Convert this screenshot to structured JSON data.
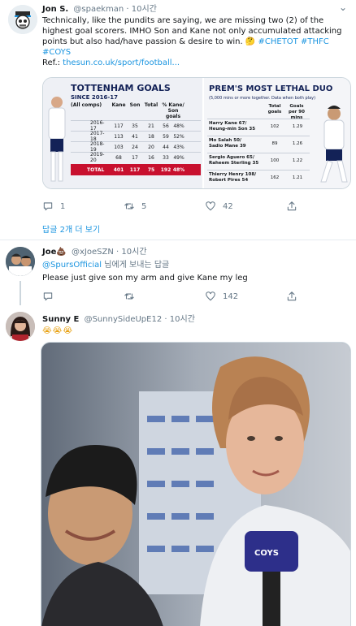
{
  "tweet1": {
    "name": "Jon S.",
    "handle": "@spaekman",
    "sep": "·",
    "time": "10시간",
    "line1": "Technically, like the pundits are saying, we are missing two (2) of the",
    "line2": "highest goal scorers. IMHO Son and Kane not only accumulated attacking",
    "line3a": "points but also had/have passion & desire to win. ",
    "line3emoji": "🤔",
    "line3b": " #CHETOT #THFC",
    "line4": "#COYS",
    "ref_prefix": "Ref.: ",
    "ref_link": "thesun.co.uk/sport/football...",
    "image": {
      "left_title": "TOTTENHAM GOALS",
      "left_subtitle": "SINCE 2016-17",
      "headers": [
        "(All comps)",
        "Kane",
        "Son",
        "Total",
        "% Kane/ Son goals"
      ],
      "rows": [
        [
          "2016-17",
          "117",
          "35",
          "21",
          "56",
          "48%"
        ],
        [
          "2017-18",
          "113",
          "41",
          "18",
          "59",
          "52%"
        ],
        [
          "2018-19",
          "103",
          "24",
          "20",
          "44",
          "43%"
        ],
        [
          "2019-20",
          "68",
          "17",
          "16",
          "33",
          "49%"
        ]
      ],
      "total_row": [
        "TOTAL",
        "401",
        "117",
        "75",
        "192",
        "48%"
      ],
      "right_title": "PREM'S MOST LETHAL DUO",
      "right_subtitle": "(5,000 mins or more together. Data when both play)",
      "right_headers": [
        "Total goals",
        "Goals per 90 mins"
      ],
      "duos": [
        {
          "name1": "Harry Kane 67/",
          "name2": "Heung-min Son ",
          "n2val": "35",
          "total": "102",
          "per90": "1.29"
        },
        {
          "name1": "Mo Salah 50/",
          "name2": "Sadio Mane ",
          "n2val": "39",
          "total": "89",
          "per90": "1.26"
        },
        {
          "name1": "Sergio Aguero 65/",
          "name2": "Raheem Sterling ",
          "n2val": "35",
          "total": "100",
          "per90": "1.22"
        },
        {
          "name1": "Thierry Henry 108/",
          "name2": "Robert Pires ",
          "n2val": "54",
          "total": "162",
          "per90": "1.21"
        }
      ]
    },
    "replies": "1",
    "retweets": "5",
    "likes": "42",
    "show_replies": "답글 2개 더 보기"
  },
  "tweet2": {
    "name": "Joe",
    "name_emoji": "💩",
    "handle": "@xJoeSZN",
    "sep": "·",
    "time": "10시간",
    "reply_to": "@SpursOfficial",
    "reply_suffix": " 님에게 보내는 답글",
    "text": "Please just give son my arm and give Kane my leg",
    "replies": "",
    "retweets": "",
    "likes": "142"
  },
  "tweet3": {
    "name": "Sunny E",
    "handle": "@SunnySideUpE12",
    "sep": "·",
    "time": "10시간",
    "text": "😭😭😭",
    "mic_label": "COYS"
  },
  "colors": {
    "accent": "#1b95e0",
    "muted": "#657786",
    "spurs_navy": "#132257"
  }
}
